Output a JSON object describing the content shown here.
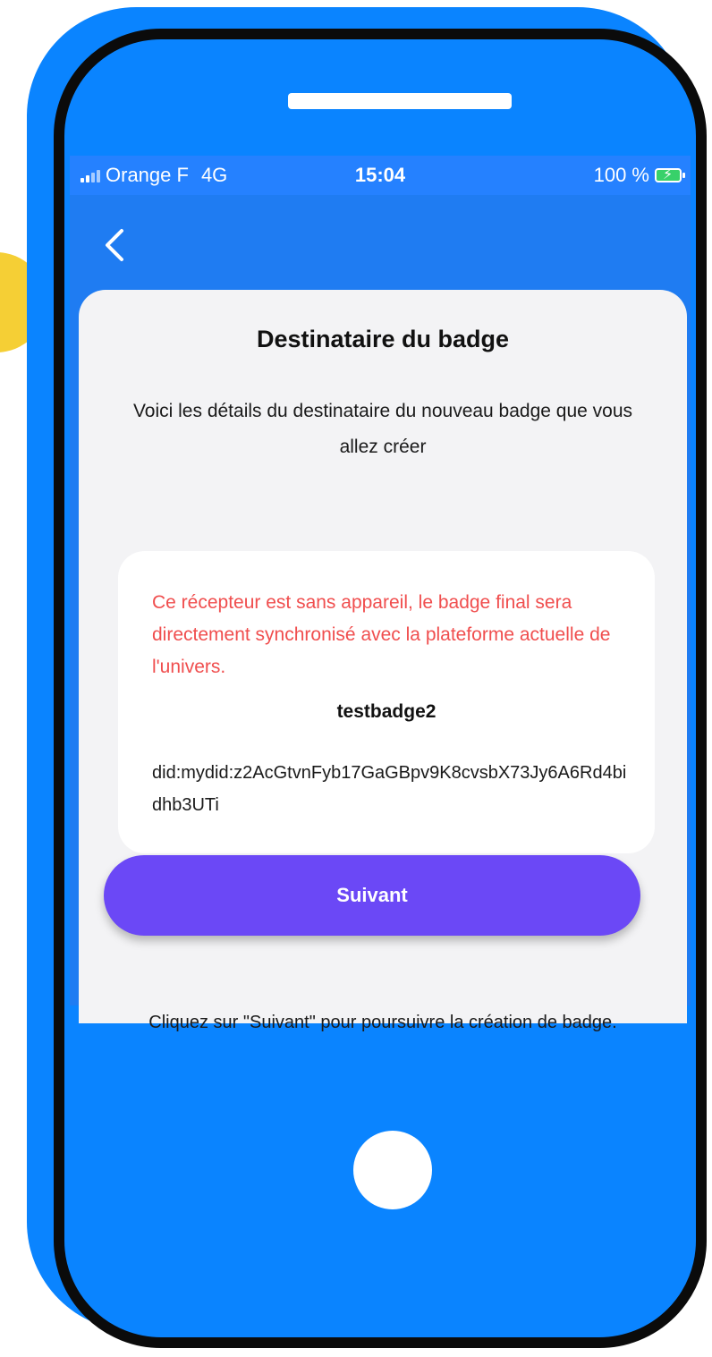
{
  "statusbar": {
    "carrier": "Orange F",
    "network": "4G",
    "time": "15:04",
    "battery_percent": "100 %"
  },
  "header": {
    "back_icon": "chevron-left-icon"
  },
  "card": {
    "title": "Destinataire du badge",
    "subtitle": "Voici les détails du destinataire du nouveau badge que vous allez créer"
  },
  "recipient": {
    "warning": "Ce récepteur est sans appareil, le badge final sera directement synchronisé avec la plateforme actuelle de l'univers.",
    "name": "testbadge2",
    "did": "did:mydid:z2AcGtvnFyb17GaGBpv9K8cvsbX73Jy6A6Rd4bidhb3UTi"
  },
  "footer": {
    "hint": "Cliquez sur \"Suivant\" pour poursuivre la création de badge.",
    "next_label": "Suivant"
  },
  "colors": {
    "brand_blue": "#0a84ff",
    "accent_purple": "#6b48f6",
    "warning_red": "#f04e4e",
    "yellow": "#f5cf35"
  }
}
